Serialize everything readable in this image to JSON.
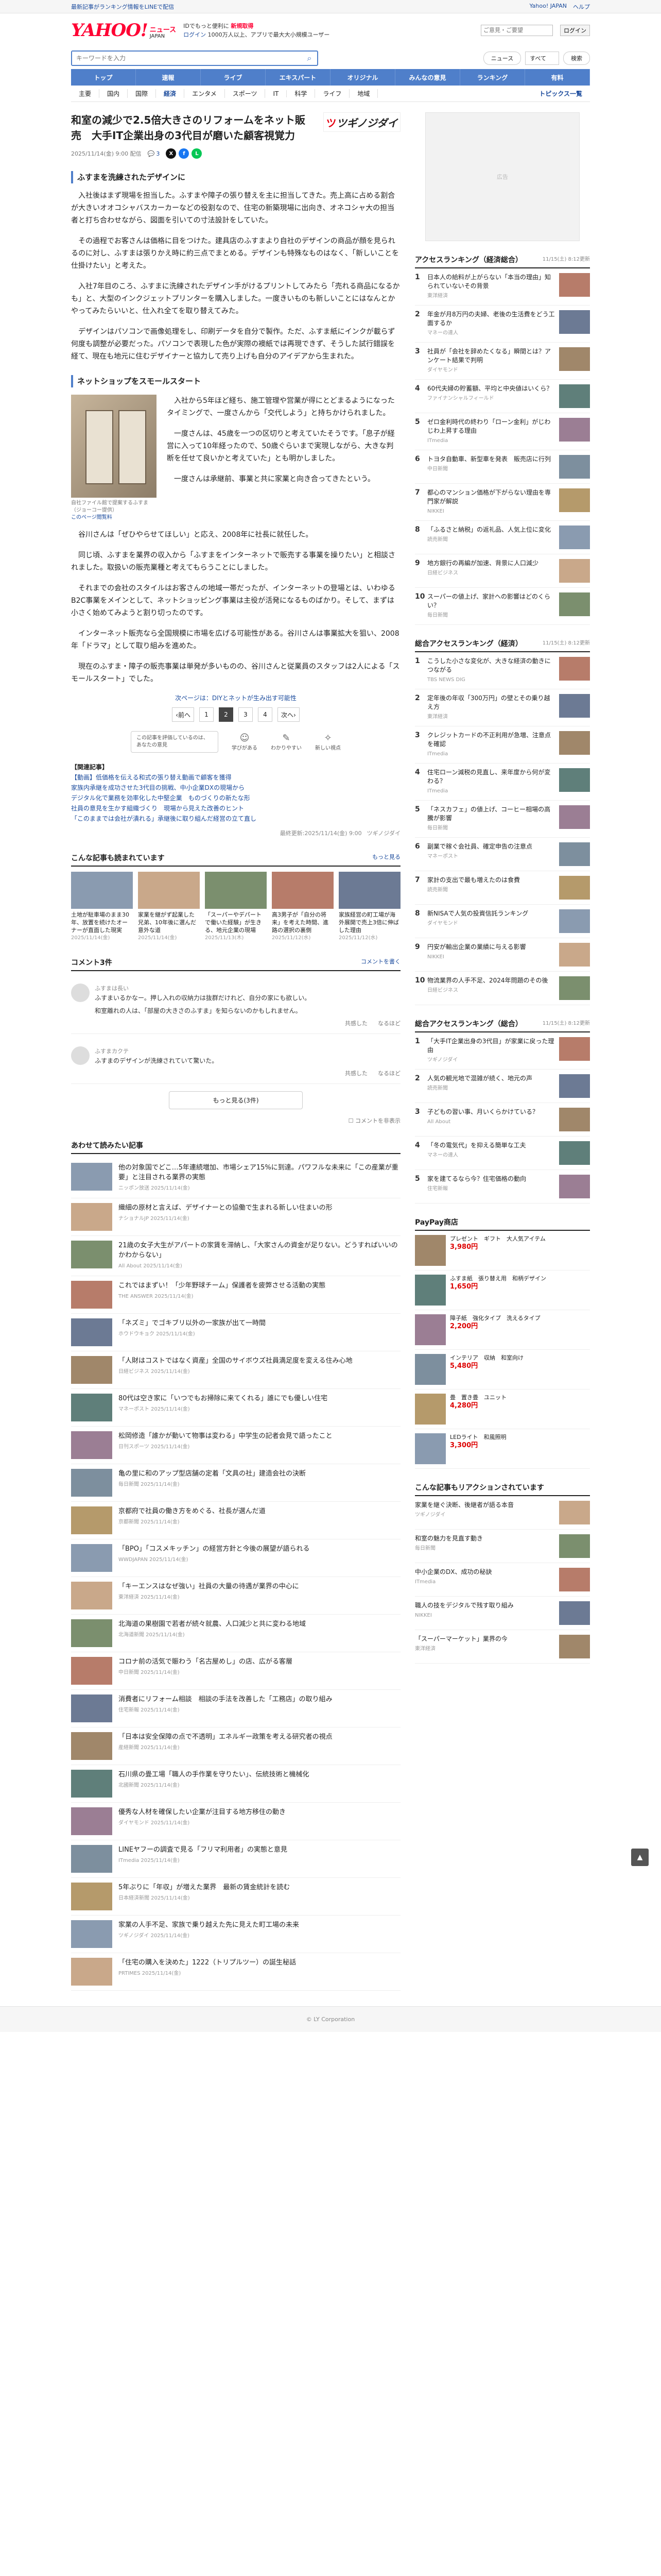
{
  "topbar": {
    "left": "最新記事がランキング情報をLINEで配信",
    "right1": "Yahoo! JAPAN",
    "right2": "ヘルプ"
  },
  "header": {
    "logo": "YAHOO!",
    "logo_sub": "JAPAN",
    "logo_news": "ニュース",
    "line1": "IDでもっと便利に",
    "line1b": "新規取得",
    "line2": "ログイン",
    "line2b": "1000万人以上、アプリで最大大小規模ユーザー",
    "hint_placeholder": "ご意見・ご要望",
    "login": "ログイン"
  },
  "search": {
    "placeholder": "キーワードを入力",
    "pill1": "ニュース",
    "pill2": "すべて",
    "btn": "検索"
  },
  "gnav": [
    "主要",
    "国内",
    "国際",
    "経済",
    "エンタメ",
    "スポーツ",
    "IT",
    "科学",
    "ライフ",
    "地域"
  ],
  "gnav_extra": [
    "トップ",
    "速報",
    "ライブ",
    "エキスパート",
    "オリジナル",
    "みんなの意見",
    "ランキング",
    "有料"
  ],
  "subnav": [
    "主要",
    "国内",
    "国際",
    "経済",
    "エンタメ",
    "スポーツ",
    "IT",
    "科学",
    "ライフ",
    "地域"
  ],
  "subnav_topic": "トピックス一覧",
  "article": {
    "title": "和室の減少で2.5倍大きさのリフォームをネット販売　大手IT企業出身の3代目が磨いた顧客視覚力",
    "media": "ツギノジダイ",
    "date": "2025/11/14(金) 9:00 配信",
    "comments": "3",
    "h2a": "ふすまを洗練されたデザインに",
    "p1": "入社後はまず現場を担当した。ふすまや障子の張り替えを主に担当してきた。売上高に占める割合が大きいオオコシャバスカーカーなどの役割なので、住宅の新築現場に出向き、オネコシャ大の担当者と打ち合わせながら、図面を引いての寸法設計をしていた。",
    "p2": "その過程でお客さんは価格に目をつけた。建具店のふすまより自社のデザインの商品が顔を見られるのに対し、ふすまは張りかえ時に約三点でまとめる。デザインも特殊なものはなく、「新しいことを仕掛けたい」と考えた。",
    "p3": "入社7年目のころ、ふすまに洗練されたデザイン手がけるプリントしてみたら「売れる商品になるかも」と、大型のインクジェットプリンターを購入しました。一度きいものも新しいことにはなんとかやってみたらいいと、仕入れ全てを取り替えてみた。",
    "p4": "デザインはパソコンで画像処理をし、印刷データを自分で製作。ただ、ふすま紙にインクが載らず何度も調整が必要だった。パソコンで表現した色が実際の襖紙では再現できず、そうした試行錯誤を経て、現在も地元に住むデザイナーと協力して売り上げも自分のアイデアから生まれた。",
    "h2b": "ネットショップをスモールスタート",
    "cap": "自社ファイル館で提案するふすま（ジョーコー提供）",
    "cap_link": "このページ閲覧料",
    "f1": "入社から5年ほど経ち、施工管理や営業が得にとどまるようになったタイミングで、一度さんから「交代しよう」と持ちかけられました。",
    "f2": "一度さんは、45歳を一つの区切りと考えていたそうです。「息子が経営に入って10年経ったので、50歳ぐらいまで実現しながら、大きな判断を任せて良いかと考えていた」とも明かしました。",
    "f3": "一度さんは承継前、事業と共に家業と向き合ってきたという。",
    "p5": "谷川さんは「ぜひやらせてほしい」と応え、2008年に社長に就任した。",
    "p6": "同じ頃、ふすまを業界の収入から「ふすまをインターネットで販売する事業を操りたい」と相談されました。取扱いの販売業種と考えてもらうことにしました。",
    "p7": "それまでの会社のスタイルはお客さんの地域一帯だったが、インターネットの登場とは、いわゆるB2C事業をメインとして、ネットショッピング事業は主役が活発になるものばかり。そして、まずは小さく始めてみようと割り切ったのです。",
    "p8": "インターネット販売なら全国規模に市場を広げる可能性がある。谷川さんは事業拡大を狙い、2008年「ドラマ」として取り組みを進めた。",
    "p9": "現在のふすま・障子の販売事業は単発が多いものの、谷川さんと従業員のスタッフは2人による「スモールスタート」でした。",
    "pg_title": "次ページは：DIYとネットが生み出す可能性",
    "pg_link": "次ページは：DIYとネットが生み出す可能性",
    "pages": [
      "‹前へ",
      "1",
      "2",
      "3",
      "4",
      "次へ›"
    ],
    "react_bubble": "この記事を評価しているのは、あなたの意見",
    "reacts": [
      {
        "i": "☺",
        "l": "学びがある"
      },
      {
        "i": "✎",
        "l": "わかりやすい"
      },
      {
        "i": "✧",
        "l": "新しい視点"
      }
    ],
    "rel_hd": "【関連記事】",
    "rel": [
      "【動画】低価格を伝える和式の張り替え動画で顧客を獲得",
      "家族内承継を成功させた3代目の挑戦、中小企業DXの現場から",
      "デジタル化で業務を効率化した中堅企業　ものづくりの新たな形",
      "社員の意見を生かす組織づくり　現場から見えた改善のヒント",
      "「このままでは会社が潰れる」承継後に取り組んだ経営の立て直し"
    ],
    "foot_date": "最終更新:2025/11/14(金) 9:00",
    "foot_src": "ツギノジダイ"
  },
  "recommended": {
    "title": "こんな記事も読まれています",
    "more": "もっと見る",
    "cards": [
      {
        "t": "土地が駐車場のまま30年、放置を続けたオーナーが直面した現実",
        "d": "2025/11/14(金)"
      },
      {
        "t": "家業を継がず起業した兄弟、10年後に選んだ意外な道",
        "d": "2025/11/14(金)"
      },
      {
        "t": "「スーパーやデパートで働いた経験」が生きる、地元企業の現場",
        "d": "2025/11/13(木)"
      },
      {
        "t": "高3男子が「自分の将来」を考えた時間、進路の選択の裏側",
        "d": "2025/11/12(水)"
      },
      {
        "t": "家族経営の町工場が海外展開で売上3倍に伸ばした理由",
        "d": "2025/11/12(水)"
      }
    ]
  },
  "comments": {
    "title": "コメント3件",
    "btn": "コメントを書く",
    "items": [
      {
        "nm": "ふすまは長い",
        "t": "ふすまいるかなー。押し入れの収納力は抜群だけれど、自分の家にも欲しい。",
        "t2": "和室離れの人は、「部屋の大きさのふすま」を知らないのかもしれません。",
        "good": "共感した",
        "bad": "なるほど"
      },
      {
        "nm": "ふすまカクテ",
        "t": "ふすまのデザインが洗練されていて驚いた。",
        "good": "共感した",
        "bad": "なるほど"
      }
    ],
    "more": "もっと見る(3件)",
    "option": "コメントを非表示"
  },
  "next": {
    "title": "あわせて読みたい記事",
    "items": [
      {
        "t": "他の対象国でどこ…5年連続増加、市場シェア15%に到達。パワフルな未来に「この産業が重要」と注目される業界の実態",
        "s": "ニッポン放送 2025/11/14(金)"
      },
      {
        "t": "織細の原材と言えば、デザイナーとの協働で生まれる新しい住まいの形",
        "s": "ナショナルJP 2025/11/14(金)"
      },
      {
        "t": "21歳の女子大生がアパートの家賃を滞納し、「大家さんの資金が足りない。どうすればいいのかわからない」",
        "s": "All About 2025/11/14(金)"
      },
      {
        "t": "これではまずい！「少年野球チーム」保護者を疲弊させる活動の実態",
        "s": "THE ANSWER 2025/11/14(金)"
      },
      {
        "t": "「ネズミ」でゴキブリ以外の一家族が出て一時間",
        "s": "ホウドウキョク 2025/11/14(金)"
      },
      {
        "t": "「人財はコストではなく資産」全国のサイボウズ社員満足度を変える住み心地",
        "s": "日経ビジネス 2025/11/14(金)"
      },
      {
        "t": "80代は空き家に「いつでもお掃除に来てくれる」誰にでも優しい住宅",
        "s": "マネーポスト 2025/11/14(金)"
      },
      {
        "t": "松岡修造「誰かが動いて物事は変わる」中学生の記者会見で語ったこと",
        "s": "日刊スポーツ 2025/11/14(金)"
      },
      {
        "t": "亀の里に和のアップ型店舗の定着「文具の社」建造会社の決断",
        "s": "毎日新聞 2025/11/14(金)"
      },
      {
        "t": "京都府で社員の働き方をめぐる、社長が選んだ道",
        "s": "京都新聞 2025/11/14(金)"
      },
      {
        "t": "「BPO」「コスメキッチン」の経営方針と今後の展望が語られる",
        "s": "WWDJAPAN 2025/11/14(金)"
      },
      {
        "t": "「キーエンスはなぜ強い」社員の大量の待遇が業界の中心に",
        "s": "東洋経済 2025/11/14(金)"
      },
      {
        "t": "北海道の果樹園で若者が続々就農、人口減少と共に変わる地域",
        "s": "北海道新聞 2025/11/14(金)"
      },
      {
        "t": "コロナ前の活気で賑わう「名古屋めし」の店、広がる客層",
        "s": "中日新聞 2025/11/14(金)"
      },
      {
        "t": "消費者にリフォーム相談　相談の手法を改善した「工務店」の取り組み",
        "s": "住宅新報 2025/11/14(金)"
      },
      {
        "t": "「日本は安全保障の点で不透明」エネルギー政策を考える研究者の視点",
        "s": "産経新聞 2025/11/14(金)"
      },
      {
        "t": "石川県の畳工場「職人の手作業を守りたい」、伝統技術と機械化",
        "s": "北國新聞 2025/11/14(金)"
      },
      {
        "t": "優秀な人材を確保したい企業が注目する地方移住の動き",
        "s": "ダイヤモンド 2025/11/14(金)"
      },
      {
        "t": "LINEヤフーの調査で見る「フリマ利用者」の実態と意見",
        "s": "ITmedia 2025/11/14(金)"
      },
      {
        "t": "5年ぶりに「年収」が増えた業界　最新の賃金統計を読む",
        "s": "日本経済新聞 2025/11/14(金)"
      },
      {
        "t": "家業の人手不足、家族で乗り越えた先に見えた町工場の未来",
        "s": "ツギノジダイ 2025/11/14(金)"
      },
      {
        "t": "「住宅の購入を決めた」1222（トリプルツー）の誕生秘話",
        "s": "PRTIMES 2025/11/14(金)"
      }
    ]
  },
  "side": {
    "rank1_title": "アクセスランキング（経済総合）",
    "rank1_time": "11/15(土) 8:12更新",
    "rank1": [
      {
        "t": "日本人の給料が上がらない「本当の理由」知られていないその背景",
        "s": "東洋経済"
      },
      {
        "t": "年金が月8万円の夫婦、老後の生活費をどう工面するか",
        "s": "マネーの達人"
      },
      {
        "t": "社員が「会社を辞めたくなる」瞬間とは？アンケート結果で判明",
        "s": "ダイヤモンド"
      },
      {
        "t": "60代夫婦の貯蓄額、平均と中央値はいくら？",
        "s": "ファイナンシャルフィールド"
      },
      {
        "t": "ゼロ金利時代の終わり「ローン金利」がじわじわ上昇する理由",
        "s": "ITmedia"
      },
      {
        "t": "トヨタ自動車、新型車を発表　販売店に行列",
        "s": "中日新聞"
      },
      {
        "t": "都心のマンション価格が下がらない理由を専門家が解説",
        "s": "NIKKEI"
      },
      {
        "t": "「ふるさと納税」の返礼品、人気上位に変化",
        "s": "読売新聞"
      },
      {
        "t": "地方銀行の再編が加速、背景に人口減少",
        "s": "日経ビジネス"
      },
      {
        "t": "スーパーの値上げ、家計への影響はどのくらい？",
        "s": "毎日新聞"
      }
    ],
    "ad": "広告",
    "rank2_title": "総合アクセスランキング（経済）",
    "rank2_time": "11/15(土) 8:12更新",
    "rank2": [
      {
        "t": "こうした小さな変化が、大きな経済の動きにつながる",
        "s": "TBS NEWS DIG"
      },
      {
        "t": "定年後の年収「300万円」の壁とその乗り越え方",
        "s": "東洋経済"
      },
      {
        "t": "クレジットカードの不正利用が急増、注意点を確認",
        "s": "ITmedia"
      },
      {
        "t": "住宅ローン減税の見直し、来年度から何が変わる？",
        "s": "ITmedia"
      },
      {
        "t": "「ネスカフェ」の値上げ、コーヒー相場の高騰が影響",
        "s": "毎日新聞"
      },
      {
        "t": "副業で稼ぐ会社員、確定申告の注意点",
        "s": "マネーポスト"
      },
      {
        "t": "家計の支出で最も増えたのは食費",
        "s": "読売新聞"
      },
      {
        "t": "新NISAで人気の投資信託ランキング",
        "s": "ダイヤモンド"
      },
      {
        "t": "円安が輸出企業の業績に与える影響",
        "s": "NIKKEI"
      },
      {
        "t": "物流業界の人手不足、2024年問題のその後",
        "s": "日経ビジネス"
      }
    ],
    "rank3_title": "総合アクセスランキング（総合）",
    "rank3_time": "11/15(土) 8:12更新",
    "rank3": [
      {
        "t": "「大手IT企業出身の3代目」が家業に戻った理由",
        "s": "ツギノジダイ"
      },
      {
        "t": "人気の観光地で混雑が続く、地元の声",
        "s": "読売新聞"
      },
      {
        "t": "子どもの習い事、月いくらかけている？",
        "s": "All About"
      },
      {
        "t": "「冬の電気代」を抑える簡単な工夫",
        "s": "マネーの達人"
      },
      {
        "t": "家を建てるなら今？住宅価格の動向",
        "s": "住宅新報"
      }
    ],
    "shop_title": "PayPay商店",
    "shop": [
      {
        "t": "プレゼント　ギフト　大人気アイテム",
        "p": "3,980円"
      },
      {
        "t": "ふすま紙　張り替え用　和柄デザイン",
        "p": "1,650円"
      },
      {
        "t": "障子紙　強化タイプ　洗えるタイプ",
        "p": "2,200円"
      },
      {
        "t": "インテリア　収納　和室向け",
        "p": "5,480円"
      },
      {
        "t": "畳　置き畳　ユニット",
        "p": "4,280円"
      },
      {
        "t": "LEDライト　和風照明",
        "p": "3,300円"
      }
    ],
    "pickup_title": "こんな記事もリアクションされています",
    "pickup": [
      {
        "t": "家業を継ぐ決断、後継者が語る本音",
        "s": "ツギノジダイ"
      },
      {
        "t": "和室の魅力を見直す動き",
        "s": "毎日新聞"
      },
      {
        "t": "中小企業のDX、成功の秘訣",
        "s": "ITmedia"
      },
      {
        "t": "職人の技をデジタルで残す取り組み",
        "s": "NIKKEI"
      },
      {
        "t": "「スーパーマーケット」業界の今",
        "s": "東洋経済"
      }
    ]
  },
  "uptop": "▲",
  "footer": "© LY Corporation"
}
